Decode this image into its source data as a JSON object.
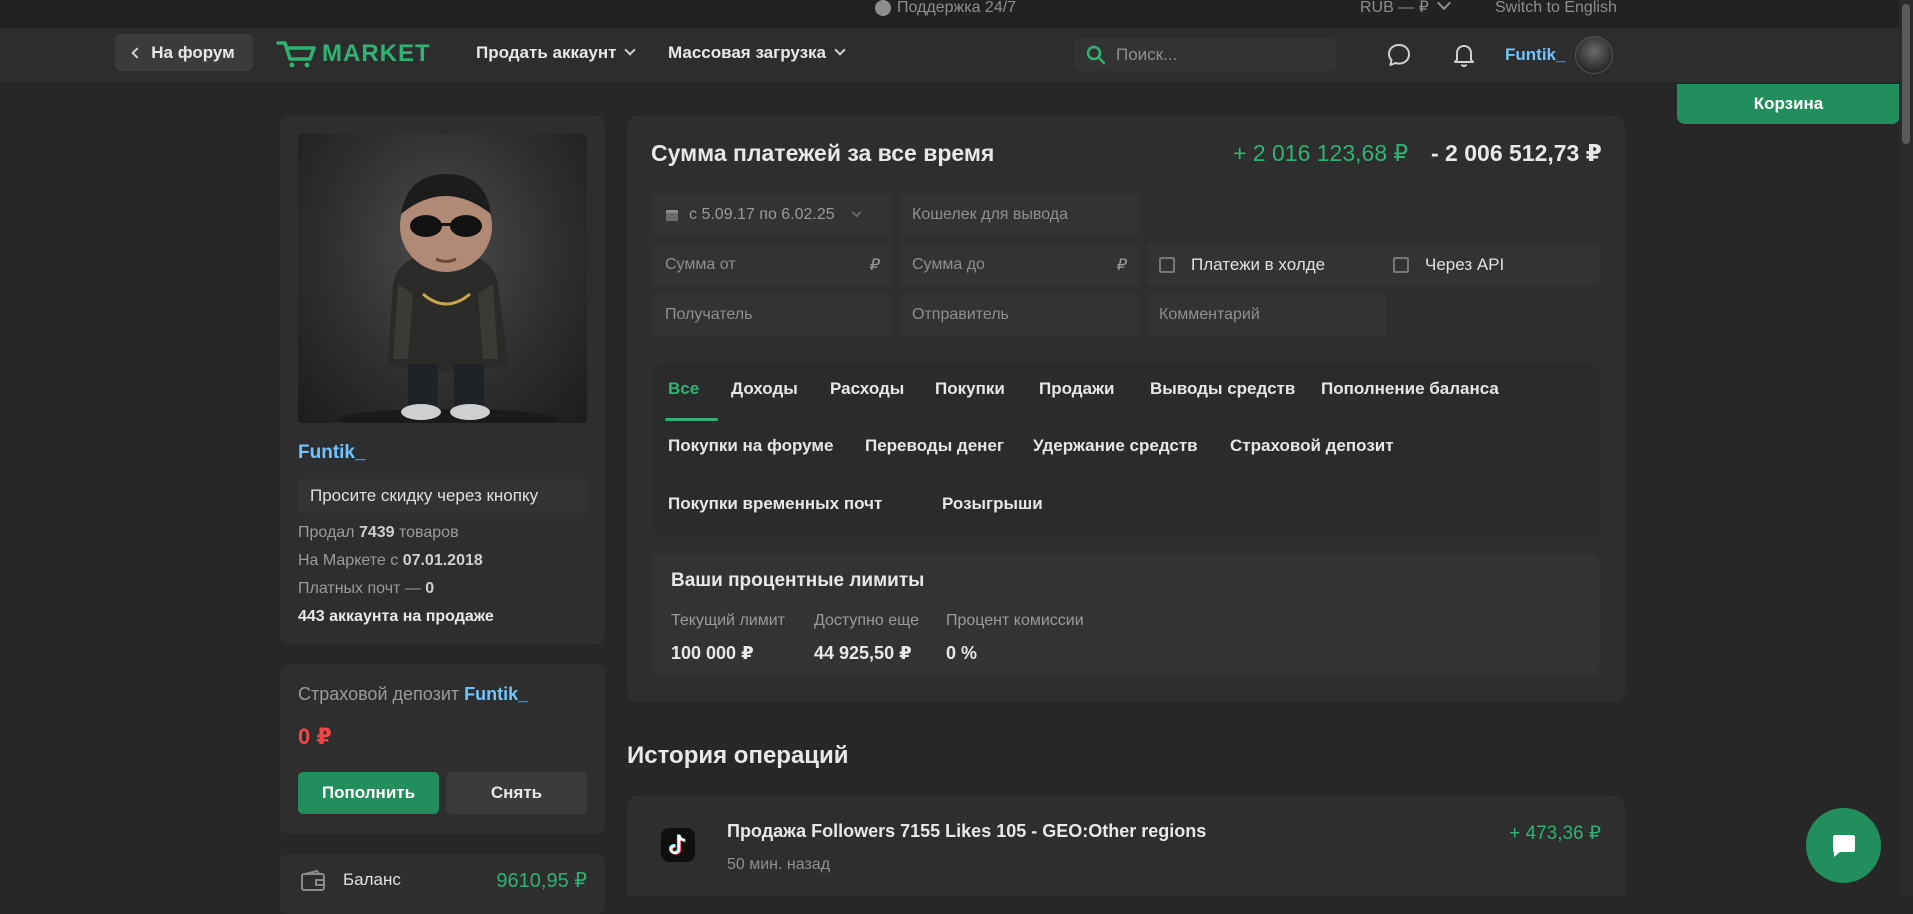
{
  "topbar": {
    "support": "Поддержка 24/7",
    "currency": "RUB — ₽",
    "language": "Switch to English"
  },
  "navbar": {
    "back_label": "На форум",
    "logo_text": "MARKET",
    "menu": [
      "Продать аккаунт",
      "Массовая загрузка"
    ],
    "search_placeholder": "Поиск...",
    "username": "Funtik_"
  },
  "cart_label": "Корзина",
  "profile": {
    "username": "Funtik_",
    "status": "Просите скидку через кнопку",
    "sold_prefix": "Продал ",
    "sold_count": "7439",
    "sold_suffix": " товаров",
    "since_prefix": "На Маркете с ",
    "since_date": "07.01.2018",
    "paid_mail_prefix": "Платных почт — ",
    "paid_mail_count": "0",
    "accounts_on_sale": "443 аккаунта на продаже"
  },
  "deposit": {
    "title_prefix": "Страховой депозит ",
    "title_user": "Funtik_",
    "amount": "0 ₽",
    "topup_label": "Пополнить",
    "withdraw_label": "Снять"
  },
  "balance": {
    "label": "Баланс",
    "amount": "9610,95 ₽"
  },
  "payments": {
    "title": "Сумма платежей за все время",
    "income": "+ 2 016 123,68 ₽",
    "expense": "- 2 006 512,73 ₽",
    "date_range": "с 5.09.17 по 6.02.25",
    "wallet_placeholder": "Кошелек для вывода",
    "sum_from_placeholder": "Сумма от",
    "sum_to_placeholder": "Сумма до",
    "rub_sign": "₽",
    "hold_label": "Платежи в холде",
    "api_label": "Через API",
    "recipient_placeholder": "Получатель",
    "sender_placeholder": "Отправитель",
    "comment_placeholder": "Комментарий"
  },
  "tabs": {
    "row1": [
      "Все",
      "Доходы",
      "Расходы",
      "Покупки",
      "Продажи",
      "Выводы средств",
      "Пополнение баланса"
    ],
    "row2": [
      "Покупки на форуме",
      "Переводы денег",
      "Удержание средств",
      "Страховой депозит"
    ],
    "row3": [
      "Покупки временных почт",
      "Розыгрыши"
    ],
    "active": "Все"
  },
  "limits": {
    "title": "Ваши процентные лимиты",
    "items": [
      {
        "label": "Текущий лимит",
        "value": "100 000 ₽"
      },
      {
        "label": "Доступно еще",
        "value": "44 925,50 ₽"
      },
      {
        "label": "Процент комиссии",
        "value": "0 %"
      }
    ]
  },
  "history": {
    "title": "История операций",
    "operations": [
      {
        "title": "Продажа Followers 7155 Likes 105 - GEO:Other regions",
        "time": "50 мин. назад",
        "amount": "+ 473,36 ₽",
        "icon": "tiktok-icon"
      }
    ]
  },
  "colors": {
    "accent": "#2fb373",
    "button_green": "#228e5d",
    "username_blue": "#6fc4ff",
    "negative": "#f04646"
  }
}
